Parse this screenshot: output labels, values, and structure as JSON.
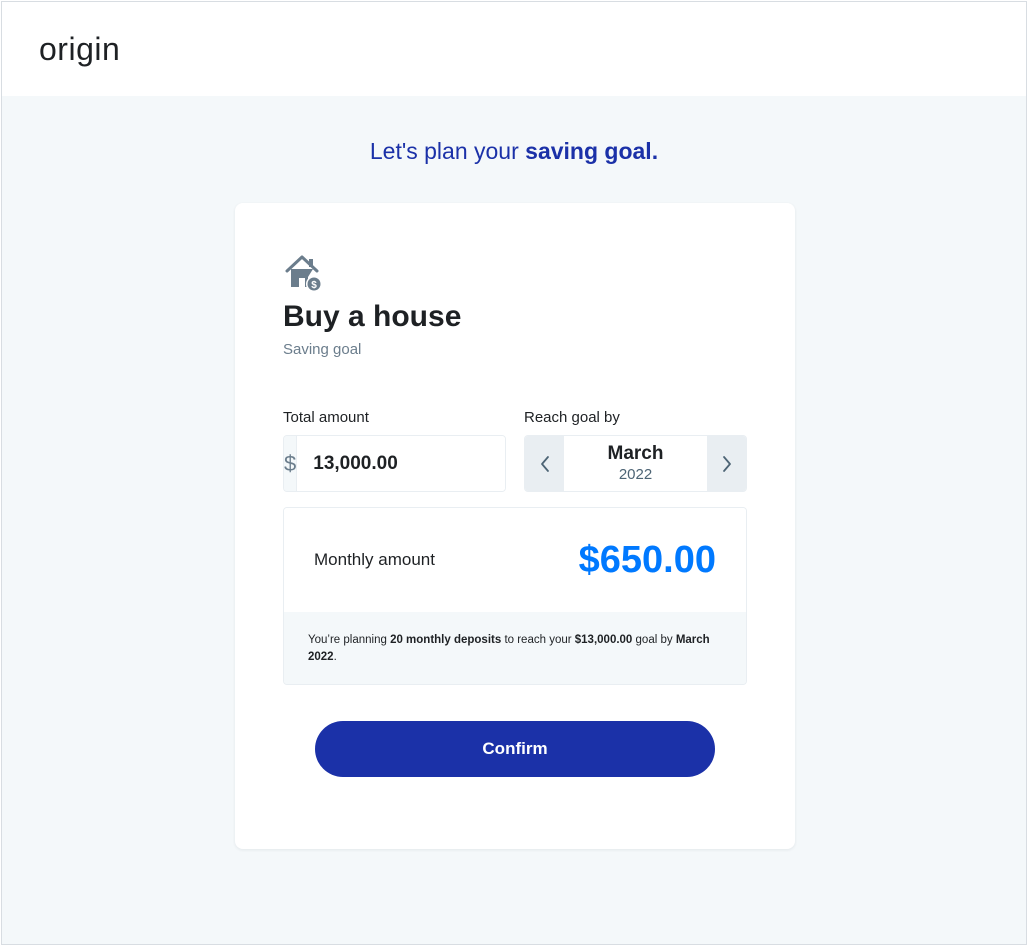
{
  "header": {
    "logo_text": "origin"
  },
  "headline": {
    "prefix": "Let's plan your ",
    "emphasis": "saving goal."
  },
  "goal": {
    "icon": "house-dollar-icon",
    "title": "Buy a house",
    "subtitle": "Saving goal"
  },
  "form": {
    "total_amount_label": "Total amount",
    "currency_symbol": "$",
    "amount_value": "13,000.00",
    "reach_goal_label": "Reach goal by",
    "month": "March",
    "year": "2022"
  },
  "summary": {
    "monthly_label": "Monthly amount",
    "monthly_value": "$650.00",
    "note": {
      "t1": "You’re planning ",
      "deposits": "20 monthly deposits",
      "t2": " to reach your ",
      "amount": "$13,000.00",
      "t3": " goal by ",
      "date": "March 2022",
      "t4": "."
    }
  },
  "actions": {
    "confirm_label": "Confirm"
  },
  "colors": {
    "brand_blue": "#1b31a8",
    "accent_blue": "#0079ff",
    "background": "#f4f8fa",
    "icon_slate": "#6b7d8c"
  }
}
